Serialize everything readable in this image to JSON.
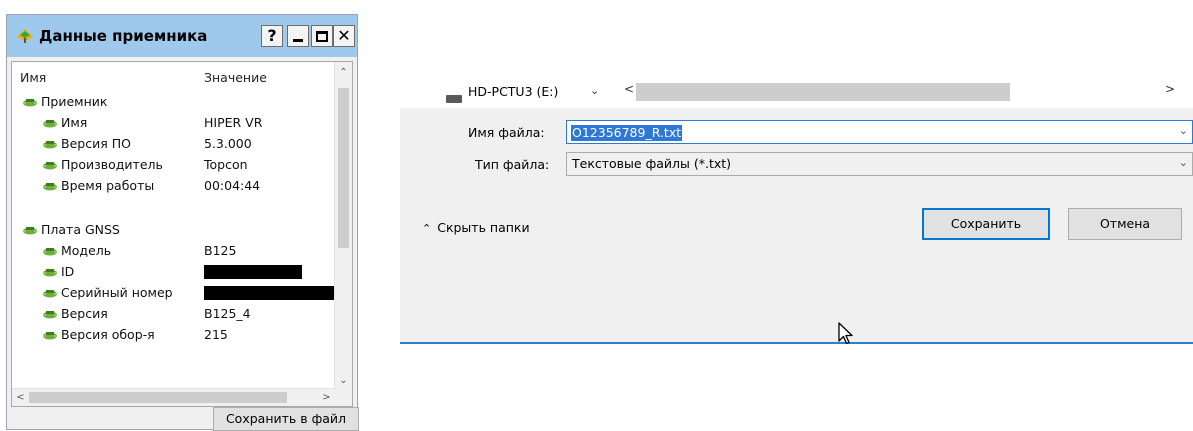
{
  "receiver_dialog": {
    "title": "Данные приемника",
    "title_buttons": {
      "help": "?",
      "close": "✕"
    },
    "columns": {
      "name": "Имя",
      "value": "Значение"
    },
    "groups": [
      {
        "label": "Приемник",
        "rows": [
          {
            "name": "Имя",
            "value": "HIPER VR"
          },
          {
            "name": "Версия ПО",
            "value": "5.3.000"
          },
          {
            "name": "Производитель",
            "value": "Topcon"
          },
          {
            "name": "Время работы",
            "value": "00:04:44"
          }
        ]
      },
      {
        "label": "Плата GNSS",
        "rows": [
          {
            "name": "Модель",
            "value": "B125"
          },
          {
            "name": "ID",
            "value": ""
          },
          {
            "name": "Серийный номер",
            "value": ""
          },
          {
            "name": "Версия",
            "value": "B125_4"
          },
          {
            "name": "Версия обор-я",
            "value": "215"
          }
        ]
      }
    ],
    "save_button": "Сохранить в файл"
  },
  "save_dialog": {
    "drive_label": "HD-PCTU3 (E:)",
    "filename_label": "Имя файла:",
    "filename_value": "O12356789_R.txt",
    "filetype_label": "Тип файла:",
    "filetype_value": "Текстовые файлы (*.txt)",
    "hide_folders": "Скрыть папки",
    "save_button": "Сохранить",
    "cancel_button": "Отмена"
  },
  "colors": {
    "titlebar": "#9ec8ec",
    "selection": "#3078d6",
    "accent": "#0078d7"
  },
  "icons": [
    "receiver-app-icon",
    "tree-node-icon",
    "drive-icon",
    "chevron-down-icon",
    "scroll-left-icon",
    "scroll-right-icon",
    "chevron-up-icon",
    "mouse-cursor-icon"
  ]
}
